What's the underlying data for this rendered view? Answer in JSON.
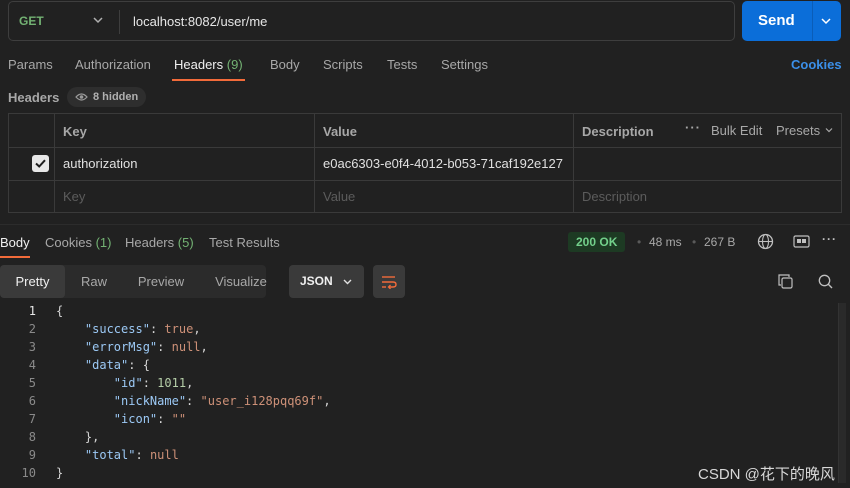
{
  "request": {
    "method": "GET",
    "url": "localhost:8082/user/me",
    "send_label": "Send",
    "method_color": "#73b273",
    "send_color": "#0b6ed9"
  },
  "request_tabs": [
    {
      "label": "Params",
      "count": ""
    },
    {
      "label": "Authorization",
      "count": ""
    },
    {
      "label": "Headers",
      "count": "(9)"
    },
    {
      "label": "Body",
      "count": ""
    },
    {
      "label": "Scripts",
      "count": ""
    },
    {
      "label": "Tests",
      "count": ""
    },
    {
      "label": "Settings",
      "count": ""
    }
  ],
  "active_request_tab": "Headers",
  "cookies_label": "Cookies",
  "headers_section": {
    "title": "Headers",
    "hidden_label": "8 hidden",
    "columns": {
      "key": "Key",
      "value": "Value",
      "description": "Description"
    },
    "bulk_edit": "Bulk Edit",
    "presets": "Presets",
    "rows": [
      {
        "checked": true,
        "key": "authorization",
        "value": "e0ac6303-e0f4-4012-b053-71caf192e127",
        "description": ""
      }
    ],
    "placeholders": {
      "key": "Key",
      "value": "Value",
      "description": "Description"
    }
  },
  "response_tabs": [
    {
      "label": "Body",
      "count": ""
    },
    {
      "label": "Cookies",
      "count": "(1)"
    },
    {
      "label": "Headers",
      "count": "(5)"
    },
    {
      "label": "Test Results",
      "count": ""
    }
  ],
  "response_meta": {
    "status": "200 OK",
    "time": "48 ms",
    "size": "267 B",
    "status_color": "#73d08b"
  },
  "view_modes": [
    "Pretty",
    "Raw",
    "Preview",
    "Visualize"
  ],
  "active_view": "Pretty",
  "format": "JSON",
  "code_lines": [
    {
      "n": "1",
      "text": "{"
    },
    {
      "n": "2",
      "text": "    \"success\": true,"
    },
    {
      "n": "3",
      "text": "    \"errorMsg\": null,"
    },
    {
      "n": "4",
      "text": "    \"data\": {"
    },
    {
      "n": "5",
      "text": "        \"id\": 1011,"
    },
    {
      "n": "6",
      "text": "        \"nickName\": \"user_i128pqq69f\","
    },
    {
      "n": "7",
      "text": "        \"icon\": \"\""
    },
    {
      "n": "8",
      "text": "    },"
    },
    {
      "n": "9",
      "text": "    \"total\": null"
    },
    {
      "n": "10",
      "text": "}"
    }
  ],
  "watermark": "CSDN @花下的晚风"
}
